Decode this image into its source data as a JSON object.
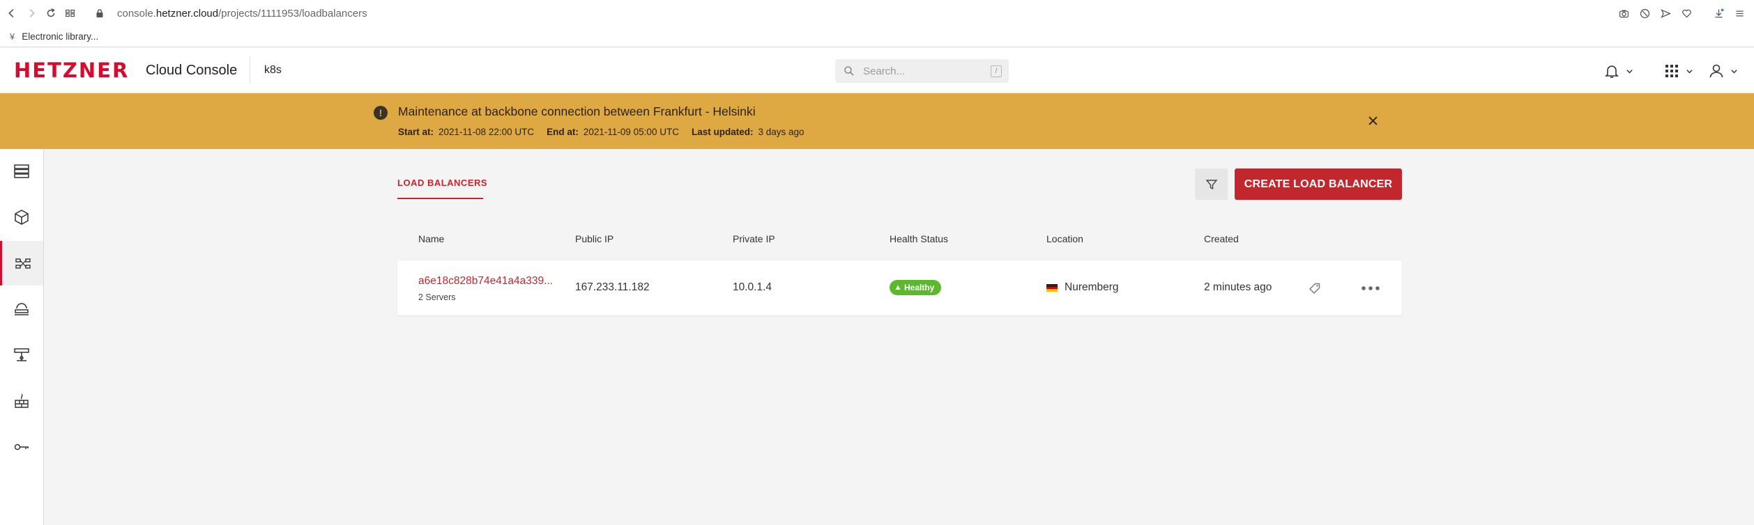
{
  "browser": {
    "url_prefix": "console.",
    "url_host": "hetzner.cloud",
    "url_path": "/projects/1111953/loadbalancers",
    "bookmark": "Electronic library..."
  },
  "header": {
    "logo": "HETZNER",
    "product": "Cloud Console",
    "project": "k8s",
    "search_placeholder": "Search...",
    "search_shortcut": "/"
  },
  "banner": {
    "title": "Maintenance at backbone connection between Frankfurt - Helsinki",
    "start_label": "Start at:",
    "start_value": "2021-11-08 22:00 UTC",
    "end_label": "End at:",
    "end_value": "2021-11-09 05:00 UTC",
    "updated_label": "Last updated:",
    "updated_value": "3 days ago"
  },
  "page": {
    "tab": "LOAD BALANCERS",
    "create_button": "CREATE LOAD BALANCER"
  },
  "table": {
    "columns": [
      "Name",
      "Public IP",
      "Private IP",
      "Health Status",
      "Location",
      "Created"
    ],
    "rows": [
      {
        "name": "a6e18c828b74e41a4a339...",
        "servers": "2 Servers",
        "public_ip": "167.233.11.182",
        "private_ip": "10.0.1.4",
        "health": "Healthy",
        "location": "Nuremberg",
        "created": "2 minutes ago"
      }
    ]
  },
  "colors": {
    "brand": "#d50c2d",
    "accent": "#c1272d",
    "banner": "#dea843",
    "healthy": "#5cb82d"
  }
}
